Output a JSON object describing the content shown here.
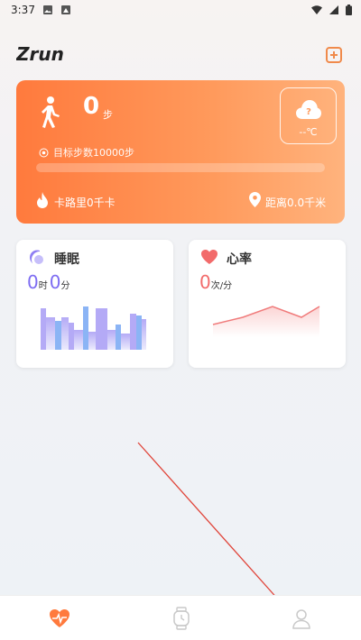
{
  "status_bar": {
    "time": "3:37"
  },
  "header": {
    "logo_text": "Zrun",
    "add_icon": "plus-square-icon"
  },
  "steps_card": {
    "steps": "0",
    "steps_unit": "步",
    "target_label": "目标步数10000步",
    "progress_fraction": 0,
    "calories_label": "卡路里0千卡",
    "distance_label": "距离0.0千米",
    "weather_icon": "cloud-question-icon",
    "temperature": "--℃",
    "gradient_colors": [
      "#ff7a3d",
      "#ffb37d"
    ]
  },
  "sleep_card": {
    "title": "睡眠",
    "hours": "0",
    "hours_unit": "时",
    "minutes": "0",
    "minutes_unit": "分",
    "accent_color": "#7d6cf2",
    "icon": "moon-icon"
  },
  "heart_card": {
    "title": "心率",
    "value": "0",
    "unit": "次/分",
    "accent_color": "#f26b6b",
    "icon": "heart-icon"
  },
  "bottom_nav": {
    "items": [
      {
        "icon": "heartbeat-icon",
        "active": true
      },
      {
        "icon": "watch-icon",
        "active": false
      },
      {
        "icon": "profile-icon",
        "active": false
      }
    ]
  }
}
